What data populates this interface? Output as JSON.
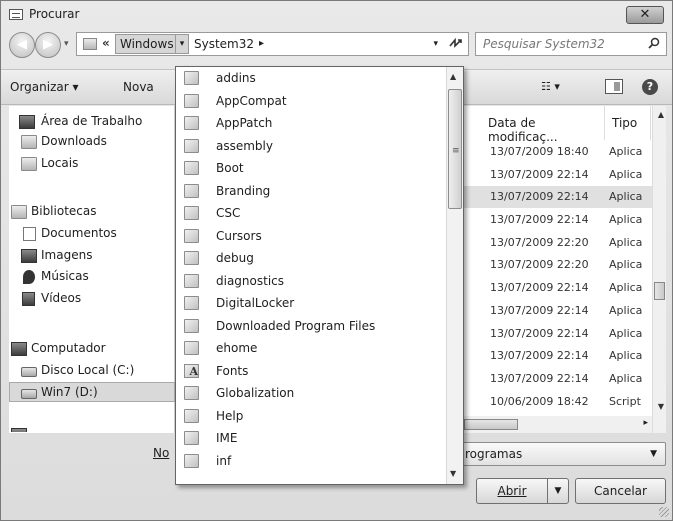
{
  "window": {
    "title": "Procurar",
    "close_glyph": "✕"
  },
  "nav": {
    "back_glyph": "◀",
    "forward_glyph": "▶",
    "history_glyph": "▾",
    "address": {
      "chevron": "«",
      "crumb1": "Windows",
      "crumb1_arrow": "▾",
      "crumb2": "System32",
      "crumb2_arrow": "▸",
      "dropdown_glyph": "▾",
      "refresh_glyph": "⁴↗"
    },
    "search": {
      "placeholder": "Pesquisar System32"
    }
  },
  "toolbar": {
    "organize": "Organizar ▾",
    "new_folder": "Nova",
    "views": "☷ ▾",
    "help": "?"
  },
  "navpane": {
    "items": [
      {
        "label": "Área de Trabalho",
        "icon": "desktop-icon"
      },
      {
        "label": "Downloads",
        "icon": "downloads-icon"
      },
      {
        "label": "Locais",
        "icon": "recent-places-icon"
      },
      {
        "label": "Bibliotecas",
        "icon": "libraries-icon"
      },
      {
        "label": "Documentos",
        "icon": "documents-icon"
      },
      {
        "label": "Imagens",
        "icon": "pictures-icon"
      },
      {
        "label": "Músicas",
        "icon": "music-icon"
      },
      {
        "label": "Vídeos",
        "icon": "videos-icon"
      },
      {
        "label": "Computador",
        "icon": "computer-icon"
      },
      {
        "label": "Disco Local (C:)",
        "icon": "drive-icon"
      },
      {
        "label": "Win7 (D:)",
        "icon": "drive-icon"
      }
    ]
  },
  "filelist": {
    "columns": {
      "date": "Data de modificaç...",
      "type": "Tipo"
    },
    "rows": [
      {
        "date": "13/07/2009 18:40",
        "type": "Aplica"
      },
      {
        "date": "13/07/2009 22:14",
        "type": "Aplica"
      },
      {
        "date": "13/07/2009 22:14",
        "type": "Aplica"
      },
      {
        "date": "13/07/2009 22:14",
        "type": "Aplica"
      },
      {
        "date": "13/07/2009 22:20",
        "type": "Aplica"
      },
      {
        "date": "13/07/2009 22:20",
        "type": "Aplica"
      },
      {
        "date": "13/07/2009 22:14",
        "type": "Aplica"
      },
      {
        "date": "13/07/2009 22:14",
        "type": "Aplica"
      },
      {
        "date": "13/07/2009 22:14",
        "type": "Aplica"
      },
      {
        "date": "13/07/2009 22:14",
        "type": "Aplica"
      },
      {
        "date": "13/07/2009 22:14",
        "type": "Aplica"
      },
      {
        "date": "10/06/2009 18:42",
        "type": "Script"
      }
    ]
  },
  "bottom": {
    "filename_label": "No",
    "filetype_value": "rogramas",
    "open": "Abrir",
    "cancel": "Cancelar"
  },
  "dropdown": {
    "items": [
      "addins",
      "AppCompat",
      "AppPatch",
      "assembly",
      "Boot",
      "Branding",
      "CSC",
      "Cursors",
      "debug",
      "diagnostics",
      "DigitalLocker",
      "Downloaded Program Files",
      "ehome",
      "Fonts",
      "Globalization",
      "Help",
      "IME",
      "inf"
    ],
    "fonts_item_glyph": "A"
  }
}
